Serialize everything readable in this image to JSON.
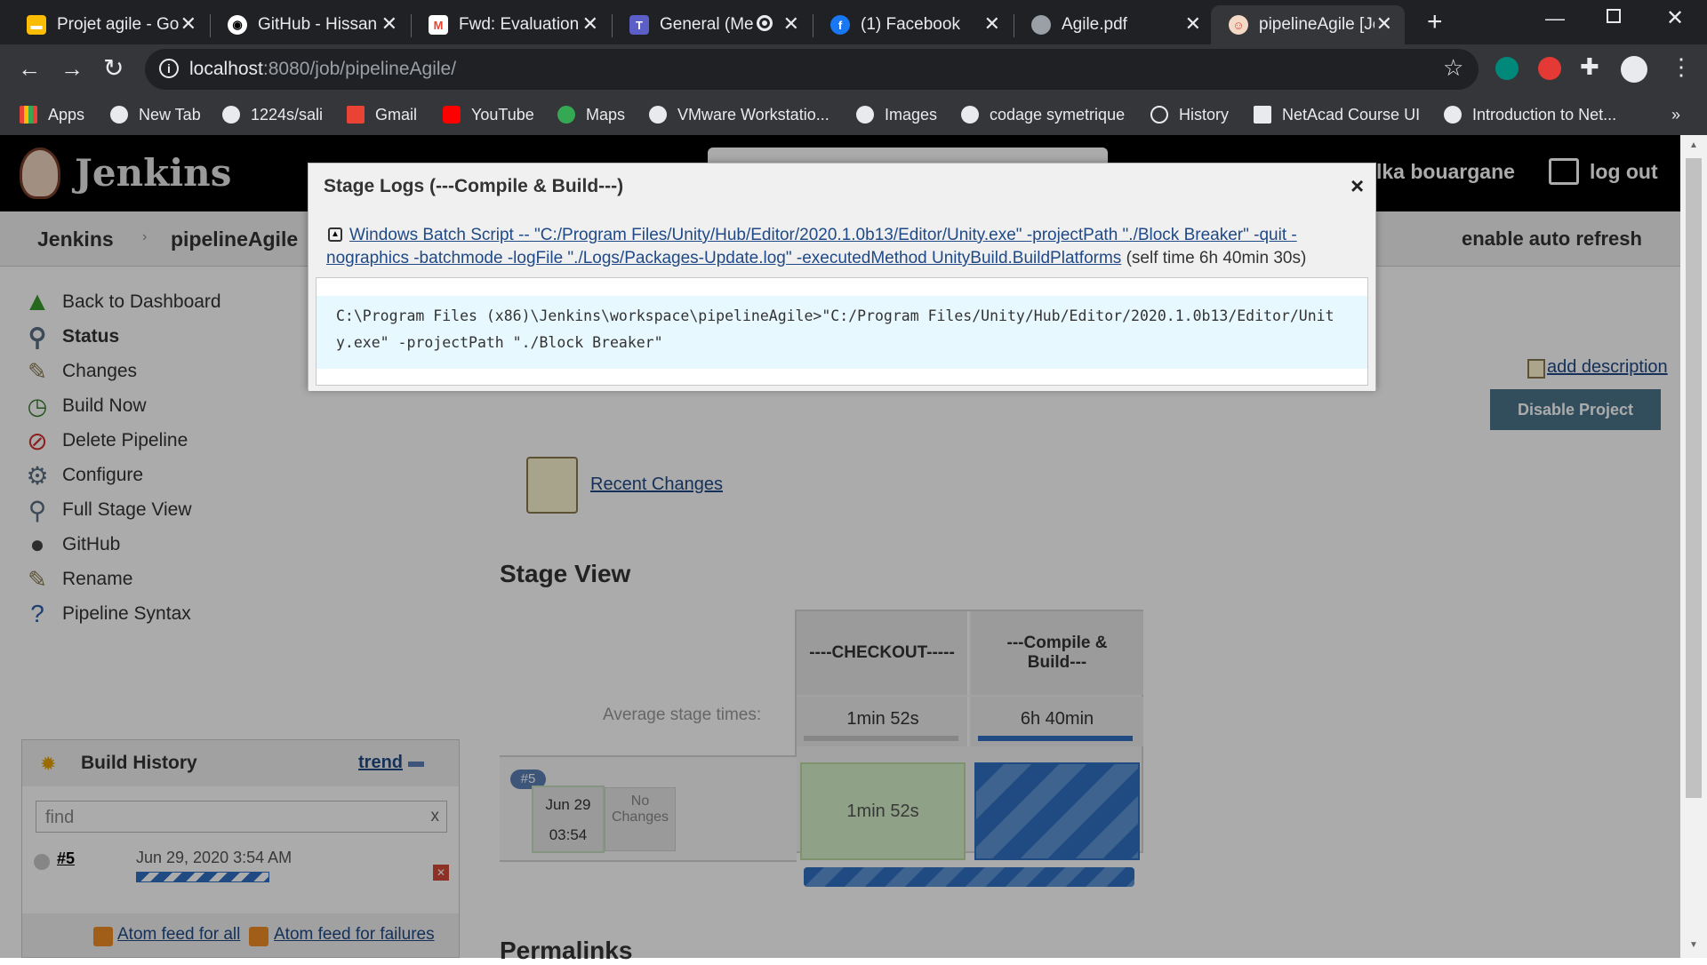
{
  "browser": {
    "tabs": [
      {
        "title": "Projet agile - Go",
        "icon": "google-docs-icon",
        "color": "#fbbc04"
      },
      {
        "title": "GitHub - Hissan",
        "icon": "github-icon",
        "color": "#ffffff"
      },
      {
        "title": "Fwd: Evaluation",
        "icon": "gmail-icon",
        "color": "#ea4335"
      },
      {
        "title": "General (Me",
        "icon": "teams-icon",
        "color": "#5b5fc7"
      },
      {
        "title": "(1) Facebook",
        "icon": "facebook-icon",
        "color": "#1877f2"
      },
      {
        "title": "Agile.pdf",
        "icon": "globe-icon",
        "color": "#9aa0a6"
      },
      {
        "title": "pipelineAgile [Je",
        "icon": "jenkins-icon",
        "color": "#d24939"
      }
    ],
    "new_tab": "+",
    "url_host": "localhost",
    "url_path": ":8080/job/pipelineAgile/",
    "bookmarks": [
      "Apps",
      "New Tab",
      "1224s/sali",
      "Gmail",
      "YouTube",
      "Maps",
      "VMware Workstatio...",
      "Images",
      "codage symetrique",
      "History",
      "NetAcad Course UI",
      "Introduction to Net..."
    ],
    "bookmarks_more": "»"
  },
  "jenkins": {
    "logo_text": "Jenkins",
    "user": "lka bouargane",
    "logout": "log out",
    "breadcrumb": [
      "Jenkins",
      "pipelineAgile"
    ],
    "auto_refresh": "enable auto refresh",
    "sidebar": [
      {
        "label": "Back to Dashboard",
        "icon": "up-arrow-icon"
      },
      {
        "label": "Status",
        "icon": "search-icon"
      },
      {
        "label": "Changes",
        "icon": "notepad-icon"
      },
      {
        "label": "Build Now",
        "icon": "clock-icon"
      },
      {
        "label": "Delete Pipeline",
        "icon": "no-entry-icon"
      },
      {
        "label": "Configure",
        "icon": "gear-icon"
      },
      {
        "label": "Full Stage View",
        "icon": "search-icon"
      },
      {
        "label": "GitHub",
        "icon": "github-icon"
      },
      {
        "label": "Rename",
        "icon": "notepad-icon"
      },
      {
        "label": "Pipeline Syntax",
        "icon": "help-icon"
      }
    ],
    "build_history": {
      "title": "Build History",
      "trend": "trend",
      "find_placeholder": "find",
      "clear": "x",
      "builds": [
        {
          "number": "#5",
          "date": "Jun 29, 2020 3:54 AM"
        }
      ],
      "atom_all": "Atom feed for all",
      "atom_failures": "Atom feed for failures"
    },
    "add_description": "add description",
    "disable_project": "Disable Project",
    "recent_changes": "Recent Changes",
    "stage_view": {
      "title": "Stage View",
      "avg_label": "Average stage times:",
      "stages": [
        {
          "name": "----CHECKOUT-----",
          "avg": "1min 52s"
        },
        {
          "name": "---Compile & Build---",
          "avg": "6h 40min"
        }
      ],
      "run": {
        "badge": "#5",
        "date": "Jun 29",
        "time": "03:54",
        "changes": "No Changes",
        "checkout_time": "1min 52s"
      }
    },
    "permalinks": "Permalinks"
  },
  "modal": {
    "title": "Stage Logs (---Compile & Build---)",
    "close": "×",
    "step_link": "Windows Batch Script -- \"C:/Program Files/Unity/Hub/Editor/2020.1.0b13/Editor/Unity.exe\" -projectPath \"./Block Breaker\" -quit -nographics -batchmode -logFile \"./Logs/Packages-Update.log\" -executedMethod UnityBuild.BuildPlatforms",
    "self_time": "(self time 6h 40min 30s)",
    "log_line": "C:\\Program Files (x86)\\Jenkins\\workspace\\pipelineAgile>\"C:/Program Files/Unity/Hub/Editor/2020.1.0b13/Editor/Unity.exe\" -projectPath \"./Block Breaker\""
  }
}
